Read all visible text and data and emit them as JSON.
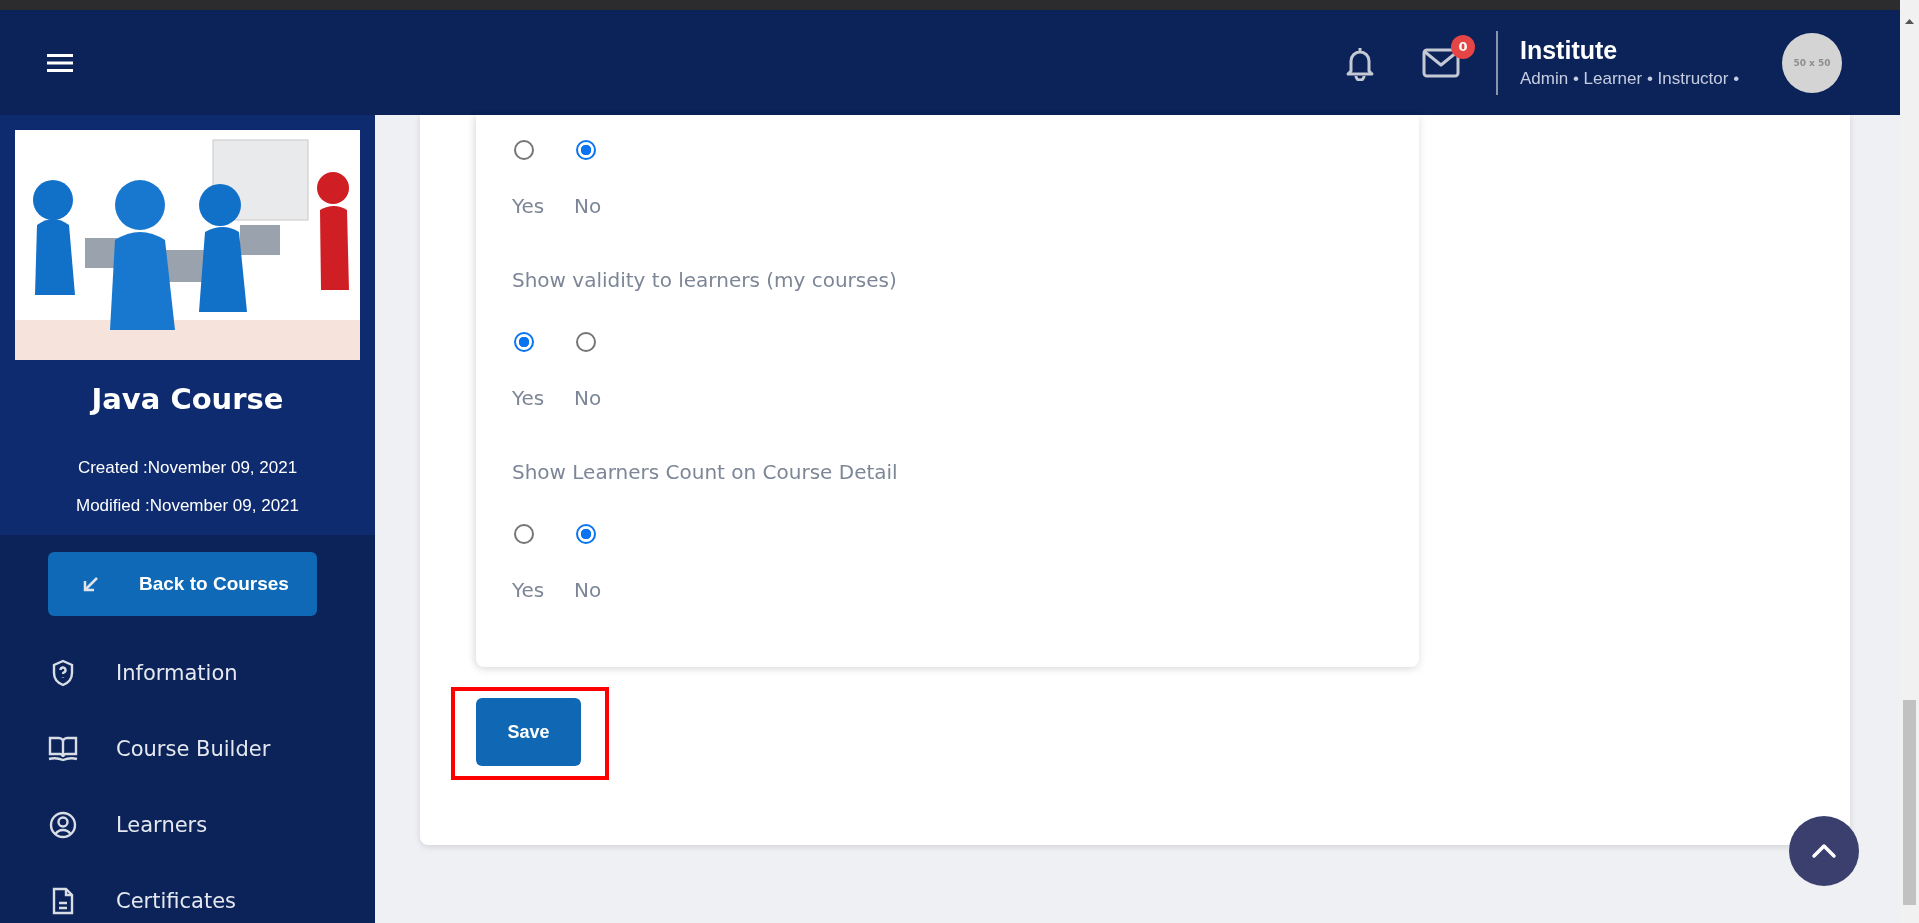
{
  "header": {
    "notifications_badge": "0",
    "user_name": "Institute",
    "user_roles": "Admin • Learner • Instructor •",
    "avatar_text": "50 x 50"
  },
  "sidebar": {
    "course_title": "Java Course",
    "created": "Created :November 09, 2021",
    "modified": "Modified :November 09, 2021",
    "back_button": "Back to Courses",
    "items": [
      {
        "label": "Information",
        "kind": "shield"
      },
      {
        "label": "Course Builder",
        "kind": "book"
      },
      {
        "label": "Learners",
        "kind": "user"
      },
      {
        "label": "Certificates",
        "kind": "document"
      }
    ]
  },
  "form": {
    "questions": [
      {
        "options": [
          {
            "label": "Yes",
            "selected": false
          },
          {
            "label": "No",
            "selected": true
          }
        ]
      },
      {
        "label": "Show validity to learners (my courses)",
        "options": [
          {
            "label": "Yes",
            "selected": true
          },
          {
            "label": "No",
            "selected": false
          }
        ]
      },
      {
        "label": "Show Learners Count on Course Detail",
        "options": [
          {
            "label": "Yes",
            "selected": false
          },
          {
            "label": "No",
            "selected": true
          }
        ]
      }
    ],
    "save_button": "Save",
    "save_highlighted": true
  }
}
